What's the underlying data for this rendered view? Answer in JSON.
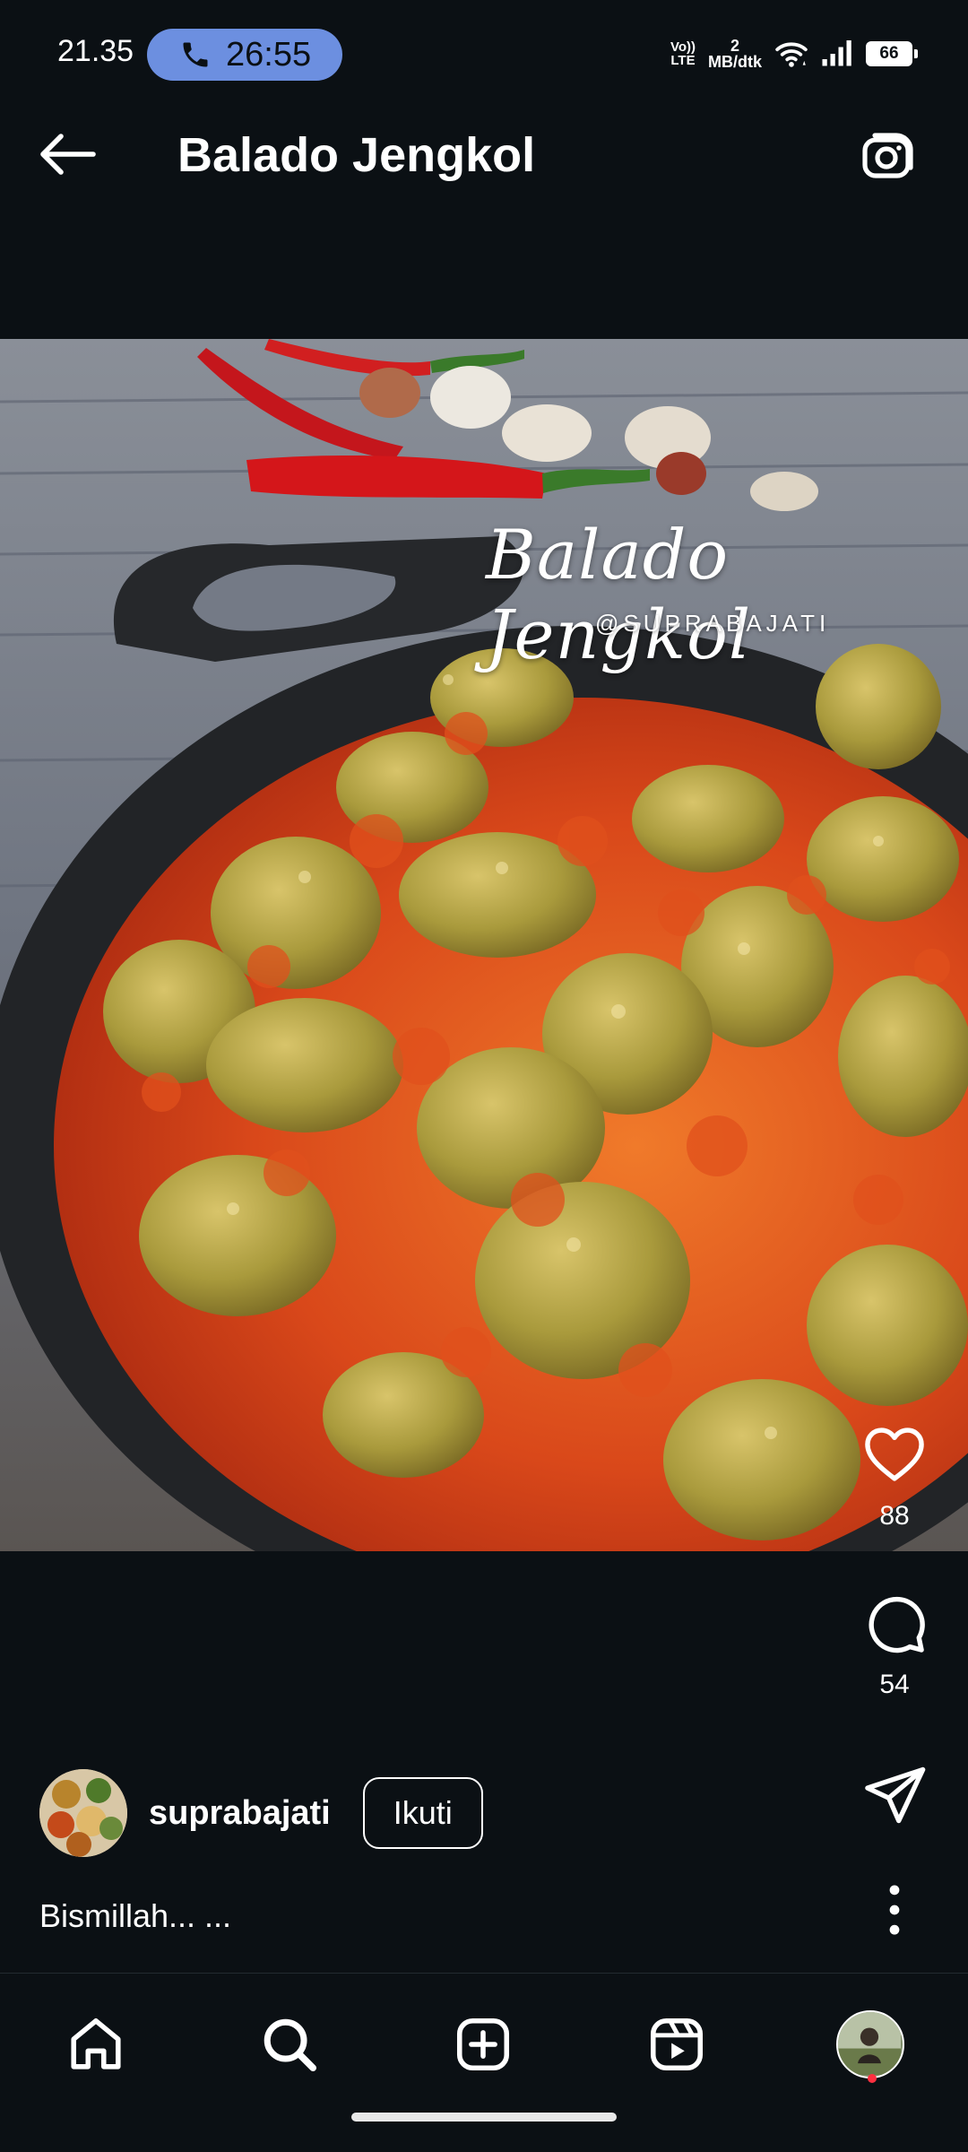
{
  "status_bar": {
    "time": "21.35",
    "call_timer": "26:55",
    "volte_label": "VoLTE",
    "volte_top": "Vo))",
    "volte_bottom": "LTE",
    "net_speed_value": "2",
    "net_speed_unit": "MB/dtk",
    "battery": "66"
  },
  "header": {
    "title": "Balado Jengkol"
  },
  "post": {
    "overlay_title": "Balado Jengkol",
    "overlay_handle": "@SUPRABAJATI",
    "likes": "88",
    "comments": "54",
    "author": "suprabajati",
    "follow_label": "Ikuti",
    "caption": "Bismillah... ..."
  },
  "colors": {
    "background": "#0b1014",
    "call_pill": "#6c8fe0",
    "notification_dot": "#ff3040"
  },
  "icons": {
    "back": "arrow-left-icon",
    "camera": "camera-icon",
    "like": "heart-icon",
    "comment": "comment-icon",
    "share": "paper-plane-icon",
    "more": "more-vertical-icon",
    "nav": [
      "home-icon",
      "search-icon",
      "add-post-icon",
      "reels-icon",
      "profile-avatar"
    ]
  }
}
